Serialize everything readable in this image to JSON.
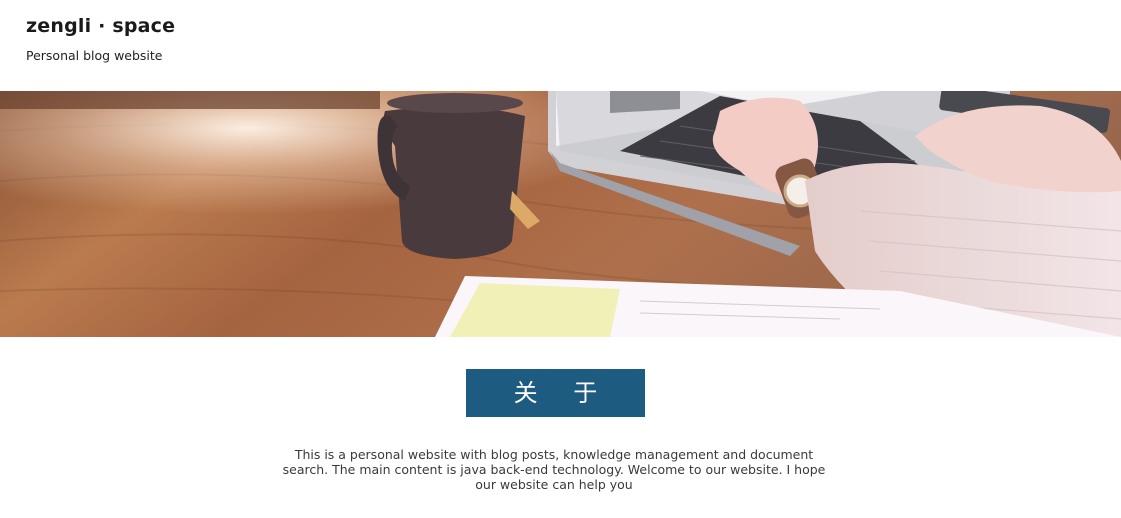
{
  "header": {
    "title": "zengli · space",
    "subtitle": "Personal blog website"
  },
  "hero": {
    "image": "laptop-desk-coffee-photo"
  },
  "about": {
    "button_label": "关 于",
    "description": "This is a personal website with blog posts, knowledge management and document search. The main content is java back-end technology. Welcome to our website. I hope our website can help you"
  },
  "colors": {
    "accent": "#1d5b80",
    "background": "#ffffff",
    "text": "#333333"
  }
}
